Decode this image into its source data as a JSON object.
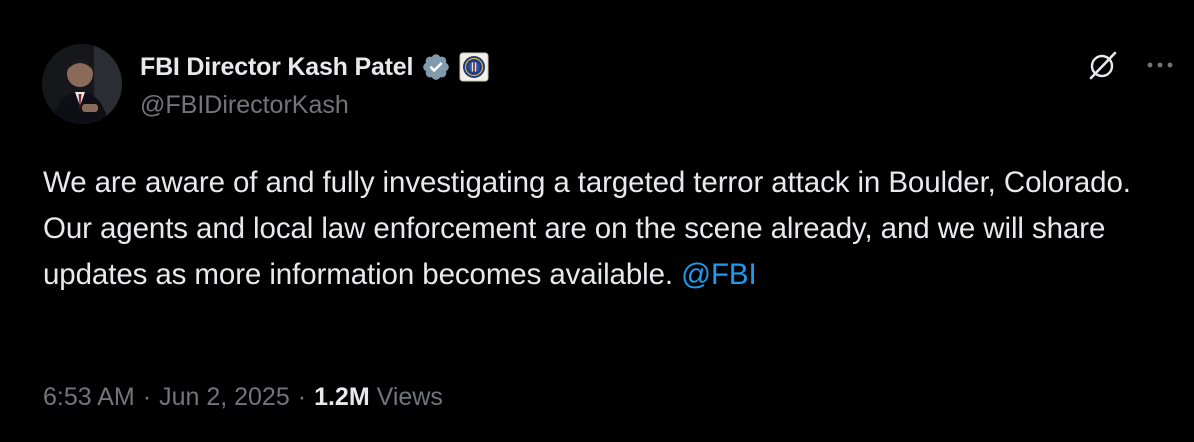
{
  "author": {
    "display_name": "FBI Director Kash Patel",
    "handle": "@FBIDirectorKash",
    "verified_badge": "verified-badge-icon",
    "affiliate_badge": "fbi-seal-icon",
    "avatar": "avatar"
  },
  "tweet": {
    "text": "We are aware of and fully investigating a targeted terror attack in Boulder, Colorado. Our agents and local law enforcement are on the scene already, and we will share updates as more information becomes available.",
    "mention": "@FBI"
  },
  "meta": {
    "time": "6:53 AM",
    "separator": "·",
    "date": "Jun 2, 2025",
    "views_count": "1.2M",
    "views_label": "Views"
  },
  "actions": {
    "grok_icon": "grok-icon",
    "more_icon": "more-icon"
  },
  "colors": {
    "background": "#000000",
    "text": "#e7e9ea",
    "secondary": "#71767b",
    "link": "#1d9bf0",
    "verified": "#829aab"
  }
}
